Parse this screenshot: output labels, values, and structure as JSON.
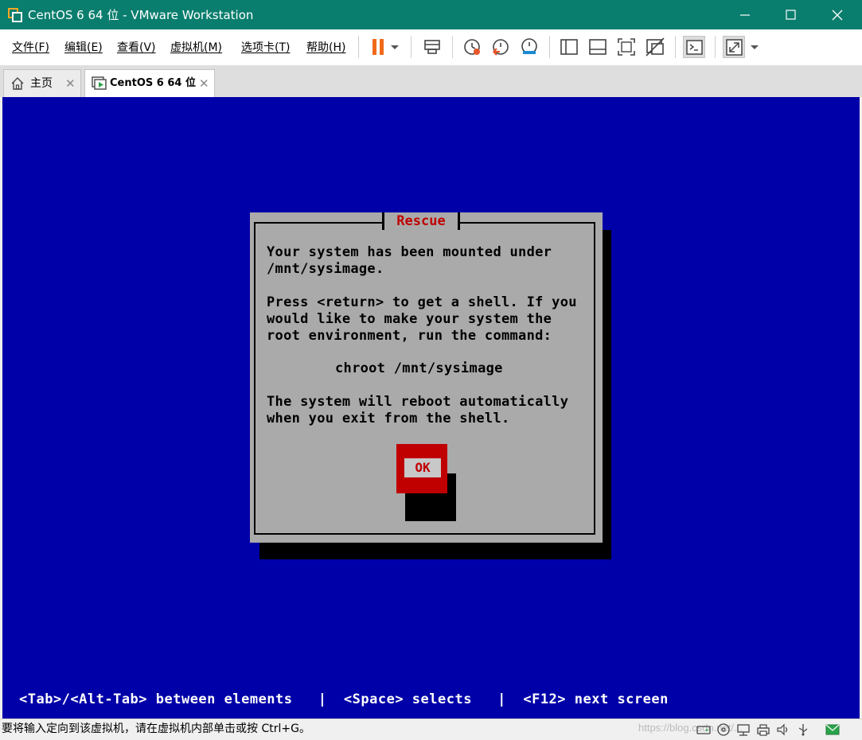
{
  "window": {
    "title": "CentOS 6 64 位 - VMware Workstation",
    "accent_color": "#0a7e6e",
    "icon": "vmware-icon"
  },
  "menu": {
    "items": [
      {
        "label": "文件(F)"
      },
      {
        "label": "编辑(E)"
      },
      {
        "label": "查看(V)"
      },
      {
        "label": "虚拟机(M)"
      },
      {
        "label": "选项卡(T)"
      },
      {
        "label": "帮助(H)"
      }
    ]
  },
  "toolbar": {
    "icons": [
      "pause-icon",
      "dropdown-icon",
      "send-ctrl-alt-del-icon",
      "snapshot-icon",
      "revert-snapshot-icon",
      "snapshot-manager-icon",
      "library-icon",
      "thumbnail-bar-icon",
      "full-screen-icon",
      "unity-icon",
      "console-view-icon",
      "stretch-guest-icon",
      "dropdown-icon"
    ],
    "pause_color": "#f06a1a"
  },
  "tabs": [
    {
      "label": "主页",
      "icon": "home-icon",
      "active": false
    },
    {
      "label": "CentOS 6 64 位",
      "icon": "vm-running-icon",
      "active": true
    }
  ],
  "console": {
    "background": "#0000a8",
    "dialog": {
      "title": "Rescue",
      "paragraph1": "Your system has been mounted under\n/mnt/sysimage.",
      "paragraph2": "Press <return> to get a shell. If you\nwould like to make your system the\nroot environment, run the command:",
      "command": "chroot /mnt/sysimage",
      "paragraph3": "The system will reboot automatically\nwhen you exit from the shell.",
      "ok_label": "OK"
    },
    "hint": "<Tab>/<Alt-Tab> between elements   |  <Space> selects   |  <F12> next screen"
  },
  "statusbar": {
    "text": "要将输入定向到该虚拟机，请在虚拟机内部单击或按 Ctrl+G。",
    "watermark": "https://blog.csdn.net/...",
    "device_icons": [
      "hard-disk-icon",
      "cd-dvd-icon",
      "network-icon",
      "printer-icon",
      "sound-icon",
      "usb-icon",
      "message-icon"
    ]
  }
}
